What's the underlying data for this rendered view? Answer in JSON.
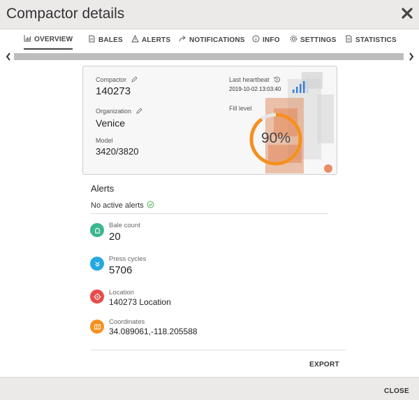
{
  "dialog": {
    "title": "Compactor details",
    "close_icon": "close-icon"
  },
  "tabs": [
    {
      "label": "OVERVIEW",
      "icon": "chart-icon",
      "active": true
    },
    {
      "label": "BALES",
      "icon": "document-icon"
    },
    {
      "label": "ALERTS",
      "icon": "warning-icon"
    },
    {
      "label": "NOTIFICATIONS",
      "icon": "share-icon"
    },
    {
      "label": "INFO",
      "icon": "info-icon"
    },
    {
      "label": "SETTINGS",
      "icon": "gear-icon"
    },
    {
      "label": "STATISTICS",
      "icon": "document-icon"
    }
  ],
  "card": {
    "compactor_label": "Compactor",
    "compactor_value": "140273",
    "organization_label": "Organization",
    "organization_value": "Venice",
    "model_label": "Model",
    "model_value": "3420/3820",
    "heartbeat_label": "Last heartbeat",
    "heartbeat_value": "2019-10-02 13:03:40",
    "fill_label": "Fill level",
    "fill_text": "90%",
    "fill_fraction": 0.9,
    "signal_bars_active": 4,
    "signal_bars_total": 5
  },
  "alerts": {
    "title": "Alerts",
    "status": "No active alerts"
  },
  "stats": {
    "bale_count_label": "Bale count",
    "bale_count_value": "20",
    "press_cycles_label": "Press cycles",
    "press_cycles_value": "5706",
    "location_label": "Location",
    "location_value": "140273 Location",
    "coordinates_label": "Coordinates",
    "coordinates_value": "34.089061,-118.205588"
  },
  "actions": {
    "export_label": "EXPORT",
    "close_label": "CLOSE"
  },
  "colors": {
    "accent_orange": "#f5901e",
    "bale_green": "#3cb68e",
    "press_blue": "#25a8e0",
    "location_red": "#e84b4b",
    "coordinates_orange": "#f5901e",
    "signal_blue": "#3b7fd6",
    "check_green": "#4caf50"
  }
}
